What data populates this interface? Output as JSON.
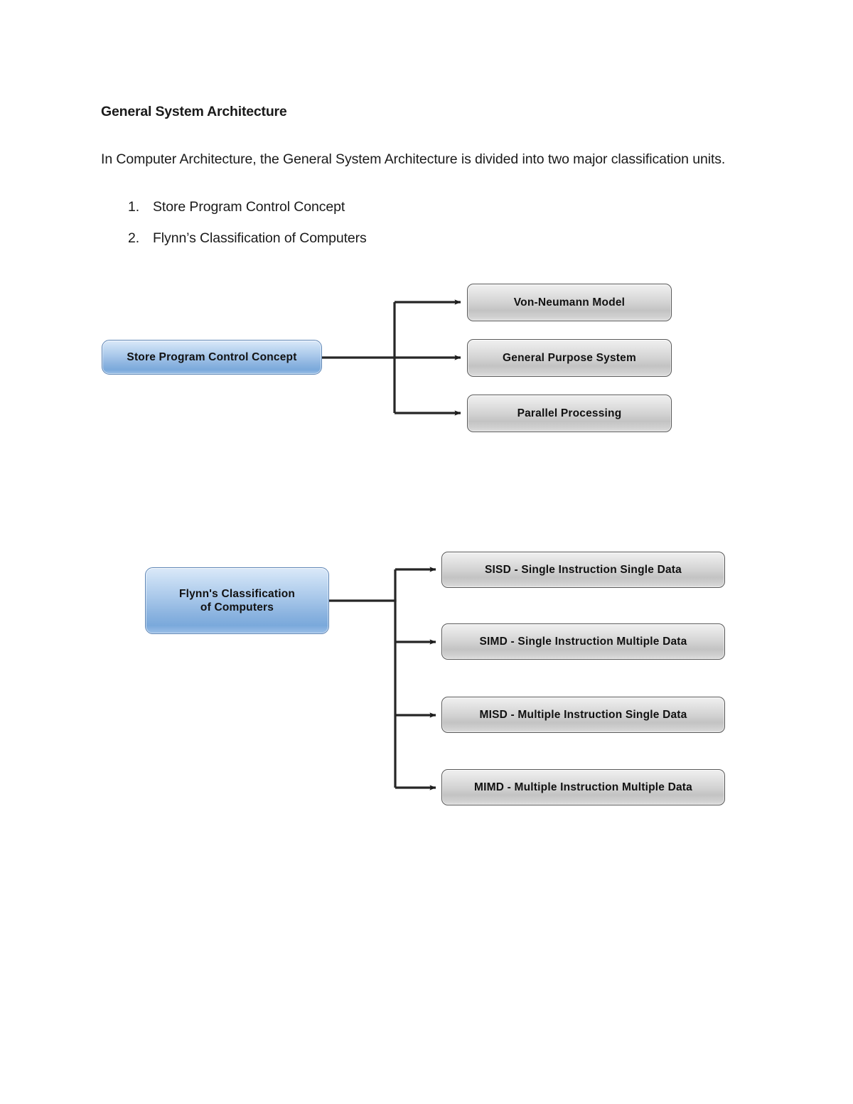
{
  "document": {
    "title": "General System Architecture",
    "paragraph": "In Computer Architecture, the General System Architecture is divided into two major classification units.",
    "list": [
      {
        "number": "1.",
        "text": "Store Program Control Concept"
      },
      {
        "number": "2.",
        "text": "Flynn’s Classification of Computers"
      }
    ]
  },
  "diagram1": {
    "root_label": "Store Program Control Concept",
    "children": [
      {
        "label": "Von-Neumann Model"
      },
      {
        "label": "General Purpose System"
      },
      {
        "label": "Parallel Processing"
      }
    ]
  },
  "diagram2": {
    "root_label": "Flynn's Classification\nof Computers",
    "children": [
      {
        "label": "SISD - Single Instruction Single Data"
      },
      {
        "label": "SIMD - Single Instruction Multiple Data"
      },
      {
        "label": "MISD - Multiple Instruction Single Data"
      },
      {
        "label": "MIMD - Multiple Instruction Multiple Data"
      }
    ]
  },
  "colors": {
    "page_background": "#ffffff",
    "text": "#1a1a1a",
    "node_blue_light": "#dbe9f9",
    "node_blue_dark": "#7aa9db",
    "node_blue_border": "#5b84b5",
    "node_grey_light": "#f0f0f0",
    "node_grey_dark": "#c3c3c3",
    "node_grey_border": "#575757",
    "connector": "#262626"
  }
}
